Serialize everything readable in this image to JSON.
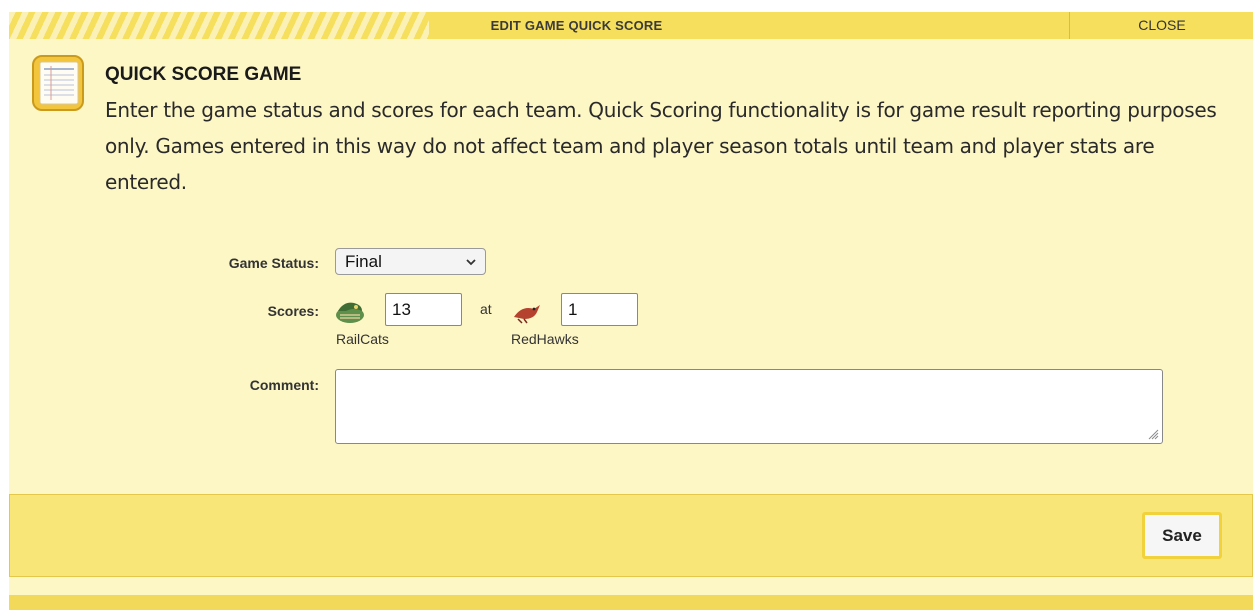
{
  "dialog": {
    "title": "EDIT GAME QUICK SCORE",
    "close_label": "CLOSE",
    "heading": "QUICK SCORE GAME",
    "description": "Enter the game status and scores for each team. Quick Scoring functionality is for game result reporting purposes only. Games entered in this way do not affect team and player season totals until team and player stats are entered."
  },
  "form": {
    "status_label": "Game Status:",
    "status_value": "Final",
    "scores_label": "Scores:",
    "separator": "at",
    "away": {
      "team": "RailCats",
      "score": "13"
    },
    "home": {
      "team": "RedHawks",
      "score": "1"
    },
    "comment_label": "Comment:",
    "comment_value": ""
  },
  "footer": {
    "save_label": "Save"
  },
  "colors": {
    "titlebar": "#f6df5c",
    "panel": "#fdf6c5",
    "footer": "#f8e678",
    "save_border": "#f1d23c"
  },
  "icons": [
    "notebook-icon",
    "railcats-logo-icon",
    "redhawks-logo-icon",
    "chevron-down-icon",
    "resize-grip-icon"
  ]
}
